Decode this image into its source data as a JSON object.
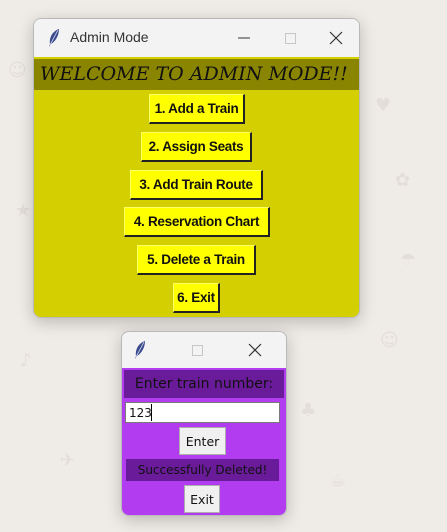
{
  "desktop": {
    "background": "#efebe6"
  },
  "admin_window": {
    "title": "Admin Mode",
    "banner": "WELCOME TO ADMIN MODE!!",
    "menu": [
      {
        "label": "1. Add a Train"
      },
      {
        "label": "2. Assign Seats"
      },
      {
        "label": "3. Add Train Route"
      },
      {
        "label": "4. Reservation Chart"
      },
      {
        "label": "5. Delete a Train"
      },
      {
        "label": "6. Exit"
      }
    ],
    "colors": {
      "client": "#d4cf00",
      "banner": "#8a8500",
      "button": "#ffff00"
    }
  },
  "delete_dialog": {
    "prompt": "Enter train number:",
    "input_value": "123",
    "enter_label": "Enter",
    "status": "Successfully Deleted!",
    "exit_label": "Exit",
    "colors": {
      "client": "#b23cf0",
      "label": "#6a1b9a"
    }
  },
  "icons": [
    "feather-icon",
    "minimize-icon",
    "maximize-icon",
    "close-icon"
  ]
}
